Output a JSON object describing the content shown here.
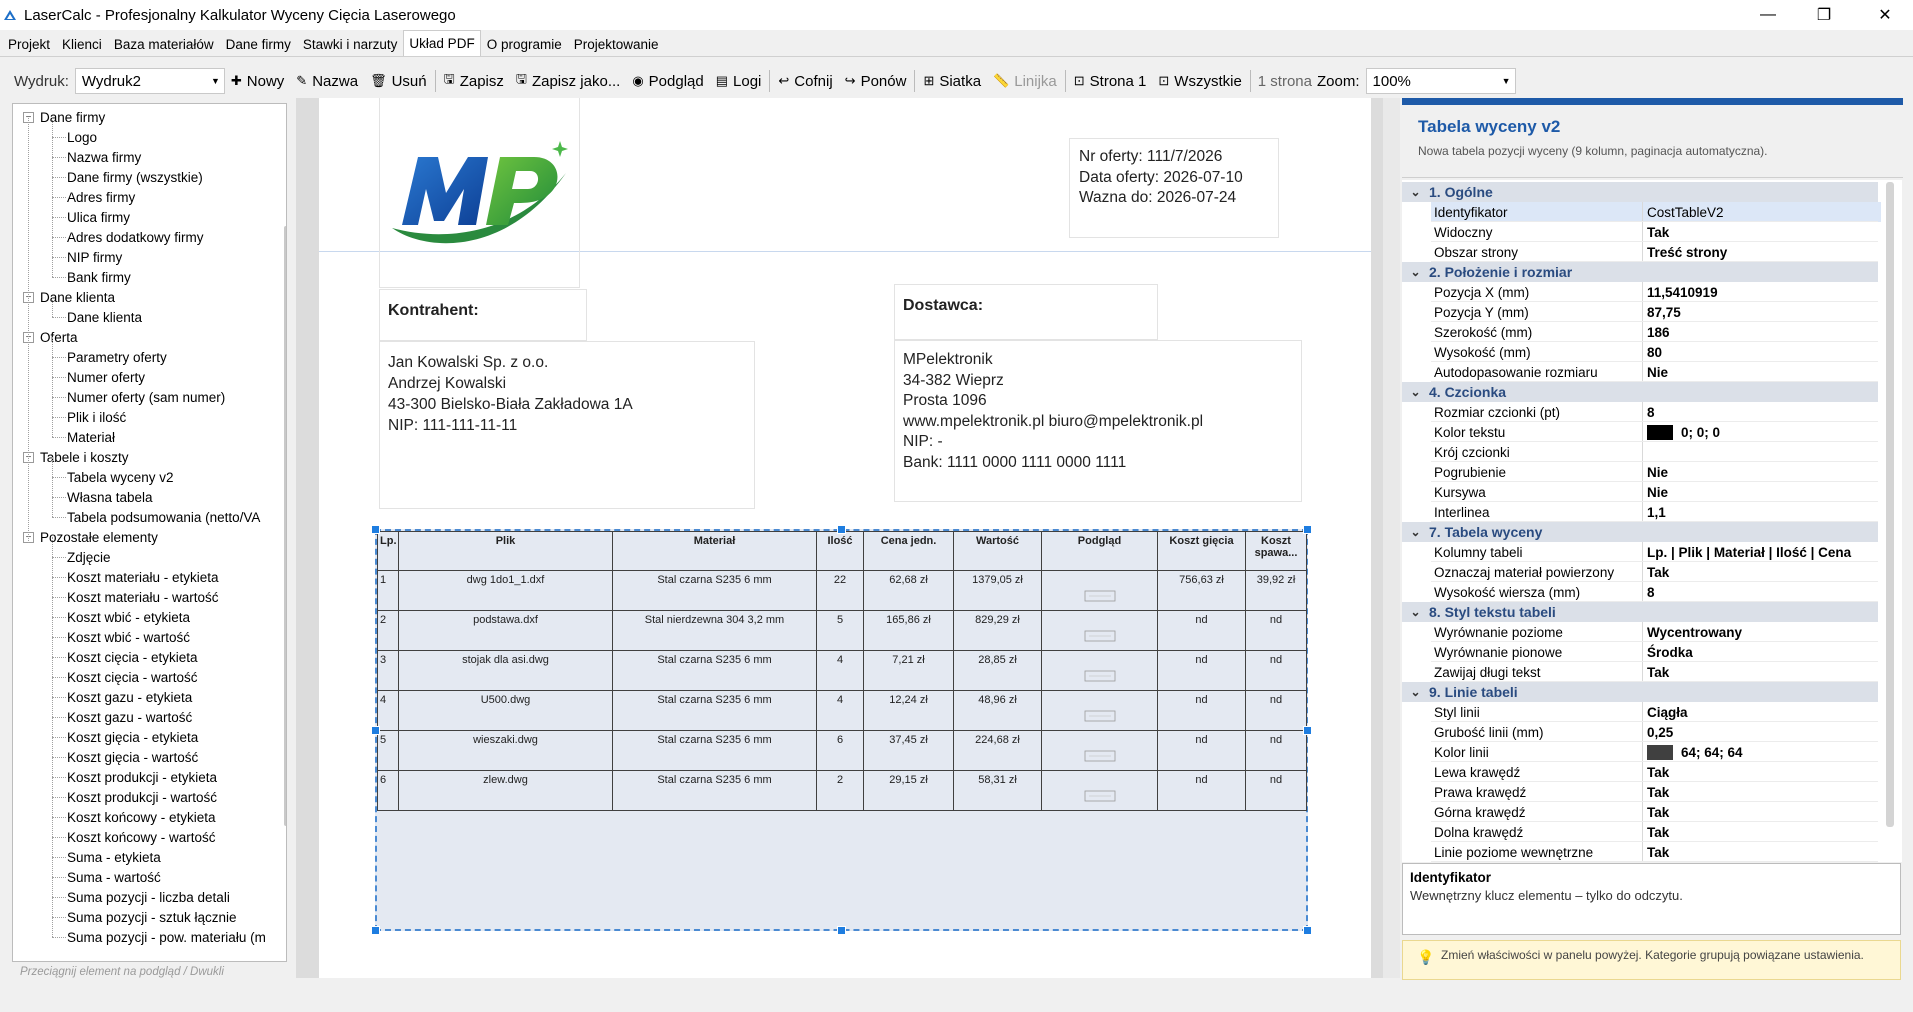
{
  "window": {
    "title": "LaserCalc - Profesjonalny Kalkulator Wyceny Cięcia Laserowego",
    "minimize": "—",
    "maximize": "❐",
    "close": "✕"
  },
  "menu": [
    "Projekt",
    "Klienci",
    "Baza materiałów",
    "Dane firmy",
    "Stawki i narzuty",
    "Układ PDF",
    "O programie",
    "Projektowanie"
  ],
  "toolbar": {
    "wydruk_label": "Wydruk:",
    "wydruk_value": "Wydruk2",
    "nowy": "Nowy",
    "nazwa": "Nazwa",
    "usun": "Usuń",
    "zapisz": "Zapisz",
    "zapisz_jako": "Zapisz jako...",
    "podglad": "Podgląd",
    "logi": "Logi",
    "cofnij": "Cofnij",
    "ponow": "Ponów",
    "siatka": "Siatka",
    "linijka": "Linijka",
    "strona1": "Strona 1",
    "wszystkie": "Wszystkie",
    "pages": "1 strona",
    "zoom_label": "Zoom:",
    "zoom_value": "100%"
  },
  "tree": [
    {
      "label": "Dane firmy",
      "level": 0
    },
    {
      "label": "Logo",
      "level": 1
    },
    {
      "label": "Nazwa firmy",
      "level": 1
    },
    {
      "label": "Dane firmy (wszystkie)",
      "level": 1
    },
    {
      "label": "Adres firmy",
      "level": 1
    },
    {
      "label": "Ulica firmy",
      "level": 1
    },
    {
      "label": "Adres dodatkowy firmy",
      "level": 1
    },
    {
      "label": "NIP firmy",
      "level": 1
    },
    {
      "label": "Bank firmy",
      "level": 1
    },
    {
      "label": "Dane klienta",
      "level": 0
    },
    {
      "label": "Dane klienta",
      "level": 1
    },
    {
      "label": "Oferta",
      "level": 0
    },
    {
      "label": "Parametry oferty",
      "level": 1
    },
    {
      "label": "Numer oferty",
      "level": 1
    },
    {
      "label": "Numer oferty (sam numer)",
      "level": 1
    },
    {
      "label": "Plik i ilość",
      "level": 1
    },
    {
      "label": "Materiał",
      "level": 1
    },
    {
      "label": "Tabele i koszty",
      "level": 0
    },
    {
      "label": "Tabela wyceny v2",
      "level": 1
    },
    {
      "label": "Własna tabela",
      "level": 1
    },
    {
      "label": "Tabela podsumowania (netto/VA",
      "level": 1
    },
    {
      "label": "Pozostałe elementy",
      "level": 0
    },
    {
      "label": "Zdjęcie",
      "level": 1
    },
    {
      "label": "Koszt materiału - etykieta",
      "level": 1
    },
    {
      "label": "Koszt materiału - wartość",
      "level": 1
    },
    {
      "label": "Koszt wbić - etykieta",
      "level": 1
    },
    {
      "label": "Koszt wbić - wartość",
      "level": 1
    },
    {
      "label": "Koszt cięcia - etykieta",
      "level": 1
    },
    {
      "label": "Koszt cięcia - wartość",
      "level": 1
    },
    {
      "label": "Koszt gazu - etykieta",
      "level": 1
    },
    {
      "label": "Koszt gazu - wartość",
      "level": 1
    },
    {
      "label": "Koszt gięcia - etykieta",
      "level": 1
    },
    {
      "label": "Koszt gięcia - wartość",
      "level": 1
    },
    {
      "label": "Koszt produkcji - etykieta",
      "level": 1
    },
    {
      "label": "Koszt produkcji - wartość",
      "level": 1
    },
    {
      "label": "Koszt końcowy - etykieta",
      "level": 1
    },
    {
      "label": "Koszt końcowy - wartość",
      "level": 1
    },
    {
      "label": "Suma - etykieta",
      "level": 1
    },
    {
      "label": "Suma - wartość",
      "level": 1
    },
    {
      "label": "Suma pozycji - liczba detali",
      "level": 1
    },
    {
      "label": "Suma pozycji - sztuk łącznie",
      "level": 1
    },
    {
      "label": "Suma pozycji - pow. materiału (m",
      "level": 1
    }
  ],
  "tree_hint": "Przeciągnij element na podgląd / Dwukli",
  "page": {
    "logo_text": "MP",
    "offer": {
      "nr": "Nr oferty: 111/7/2026",
      "data": "Data oferty: 2026-07-10",
      "wazna": "Wazna do: 2026-07-24"
    },
    "kontrahent_title": "Kontrahent:",
    "kontrahent": [
      "Jan Kowalski Sp. z o.o.",
      "Andrzej Kowalski",
      "43-300 Bielsko-Biała Zakładowa 1A",
      "NIP: 111-111-11-11"
    ],
    "dostawca_title": "Dostawca:",
    "dostawca": [
      "MPelektronik",
      "34-382 Wieprz",
      "Prosta 1096",
      "www.mpelektronik.pl  biuro@mpelektronik.pl",
      "NIP: -",
      "Bank: 1111 0000 1111 0000 1111"
    ],
    "table_headers": [
      "Lp.",
      "Plik",
      "Materiał",
      "Ilość",
      "Cena jedn.",
      "Wartość",
      "Podgląd",
      "Koszt gięcia",
      "Koszt spawa..."
    ],
    "table_rows": [
      [
        "1",
        "dwg 1do1_1.dxf",
        "Stal czarna S235 6 mm",
        "22",
        "62,68 zł",
        "1379,05 zł",
        "",
        "756,63 zł",
        "39,92 zł"
      ],
      [
        "2",
        "podstawa.dxf",
        "Stal nierdzewna 304 3,2 mm",
        "5",
        "165,86 zł",
        "829,29 zł",
        "",
        "nd",
        "nd"
      ],
      [
        "3",
        "stojak dla asi.dwg",
        "Stal czarna S235 6 mm",
        "4",
        "7,21 zł",
        "28,85 zł",
        "",
        "nd",
        "nd"
      ],
      [
        "4",
        "U500.dwg",
        "Stal czarna S235 6 mm",
        "4",
        "12,24 zł",
        "48,96 zł",
        "",
        "nd",
        "nd"
      ],
      [
        "5",
        "wieszaki.dwg",
        "Stal czarna S235 6 mm",
        "6",
        "37,45 zł",
        "224,68 zł",
        "",
        "nd",
        "nd"
      ],
      [
        "6",
        "zlew.dwg",
        "Stal czarna S235 6 mm",
        "2",
        "29,15 zł",
        "58,31 zł",
        "",
        "nd",
        "nd"
      ]
    ]
  },
  "props": {
    "title": "Tabela wyceny v2",
    "subtitle": "Nowa tabela pozycji wyceny (9 kolumn, paginacja automatyczna).",
    "categories": [
      {
        "name": "1. Ogólne",
        "rows": [
          [
            "Identyfikator",
            "CostTableV2"
          ],
          [
            "Widoczny",
            "Tak"
          ],
          [
            "Obszar strony",
            "Treść strony"
          ]
        ]
      },
      {
        "name": "2. Położenie i rozmiar",
        "rows": [
          [
            "Pozycja X (mm)",
            "11,5410919"
          ],
          [
            "Pozycja Y (mm)",
            "87,75"
          ],
          [
            "Szerokość (mm)",
            "186"
          ],
          [
            "Wysokość (mm)",
            "80"
          ],
          [
            "Autodopasowanie rozmiaru",
            "Nie"
          ]
        ]
      },
      {
        "name": "4. Czcionka",
        "rows": [
          [
            "Rozmiar czcionki (pt)",
            "8"
          ],
          [
            "Kolor tekstu",
            "0; 0; 0"
          ],
          [
            "Krój czcionki",
            ""
          ],
          [
            "Pogrubienie",
            "Nie"
          ],
          [
            "Kursywa",
            "Nie"
          ],
          [
            "Interlinea",
            "1,1"
          ]
        ]
      },
      {
        "name": "7. Tabela wyceny",
        "rows": [
          [
            "Kolumny tabeli",
            "Lp. | Plik | Materiał | Ilość | Cena"
          ],
          [
            "Oznaczaj materiał powierzony",
            "Tak"
          ],
          [
            "Wysokość wiersza (mm)",
            "8"
          ]
        ]
      },
      {
        "name": "8. Styl tekstu tabeli",
        "rows": [
          [
            "Wyrównanie poziome",
            "Wycentrowany"
          ],
          [
            "Wyrównanie pionowe",
            "Środka"
          ],
          [
            "Zawijaj długi tekst",
            "Tak"
          ]
        ]
      },
      {
        "name": "9. Linie tabeli",
        "rows": [
          [
            "Styl linii",
            "Ciągła"
          ],
          [
            "Grubość linii (mm)",
            "0,25"
          ],
          [
            "Kolor linii",
            "64; 64; 64"
          ],
          [
            "Lewa krawędź",
            "Tak"
          ],
          [
            "Prawa krawędź",
            "Tak"
          ],
          [
            "Górna krawędź",
            "Tak"
          ],
          [
            "Dolna krawędź",
            "Tak"
          ],
          [
            "Linie poziome wewnętrzne",
            "Tak"
          ]
        ]
      }
    ],
    "desc_title": "Identyfikator",
    "desc_text": "Wewnętrzny klucz elementu – tylko do odczytu.",
    "hint": "Zmień właściwości w panelu powyżej. Kategorie grupują powiązane ustawienia."
  },
  "colors": {
    "accent": "#1e5aa8",
    "text_color_swatch": "#000000",
    "line_color_swatch": "#404040"
  }
}
